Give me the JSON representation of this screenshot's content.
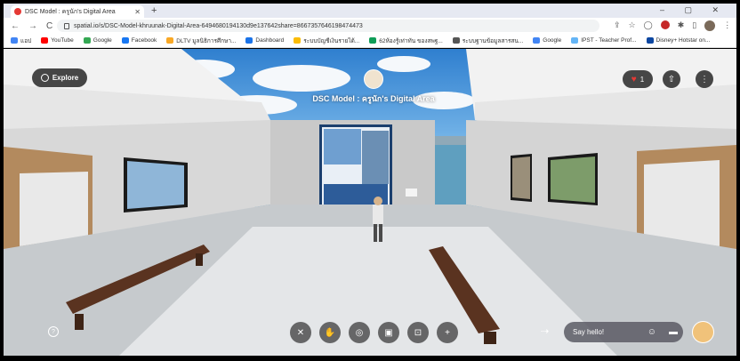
{
  "browser": {
    "tab_title": "DSC Model : ครูนัก's Digital Area",
    "new_tab": "+",
    "window_controls": "– ▢ ✕",
    "nav": {
      "back": "←",
      "forward": "→",
      "reload": "C"
    },
    "url": "spatial.io/s/DSC-Model-khruunak-Digital-Area-6494680194130d9e137642share=8667357646198474473",
    "bookmarks": [
      {
        "label": "แอป",
        "color": "#4285f4"
      },
      {
        "label": "YouTube",
        "color": "#ff0000"
      },
      {
        "label": "Google",
        "color": "#34a853"
      },
      {
        "label": "Facebook",
        "color": "#1877f2"
      },
      {
        "label": "DLTV มูลนิธิการศึกษา...",
        "color": "#f9a825"
      },
      {
        "label": "Dashboard",
        "color": "#1a73e8"
      },
      {
        "label": "ระบบบัญชีเงินรายได้...",
        "color": "#fbbc05"
      },
      {
        "label": "62ห้องรู้เท่าทัน ของสพฐ...",
        "color": "#0f9d58"
      },
      {
        "label": "ระบบฐานข้อมูลสารสน...",
        "color": "#555555"
      },
      {
        "label": "Google",
        "color": "#4285f4"
      },
      {
        "label": "IPST - Teacher Prof...",
        "color": "#64b5f6"
      },
      {
        "label": "Disney+ Hotstar on...",
        "color": "#0d47a1"
      }
    ]
  },
  "space": {
    "explore_label": "Explore",
    "title": "DSC Model : ครูนัก's Digital Area",
    "likes": "1"
  },
  "chat": {
    "placeholder": "Say hello!"
  },
  "icons": {
    "share": "⇧",
    "more": "⋮",
    "help": "?",
    "gesture": "⇢",
    "emoji": "☺",
    "messages": "▬",
    "tools": [
      "✕",
      "✋",
      "◎",
      "▣",
      "⊡",
      "+"
    ]
  },
  "colors": {
    "accent_heart": "#e53935",
    "bench": "#5a3320",
    "sky": "#2f7fcf"
  }
}
